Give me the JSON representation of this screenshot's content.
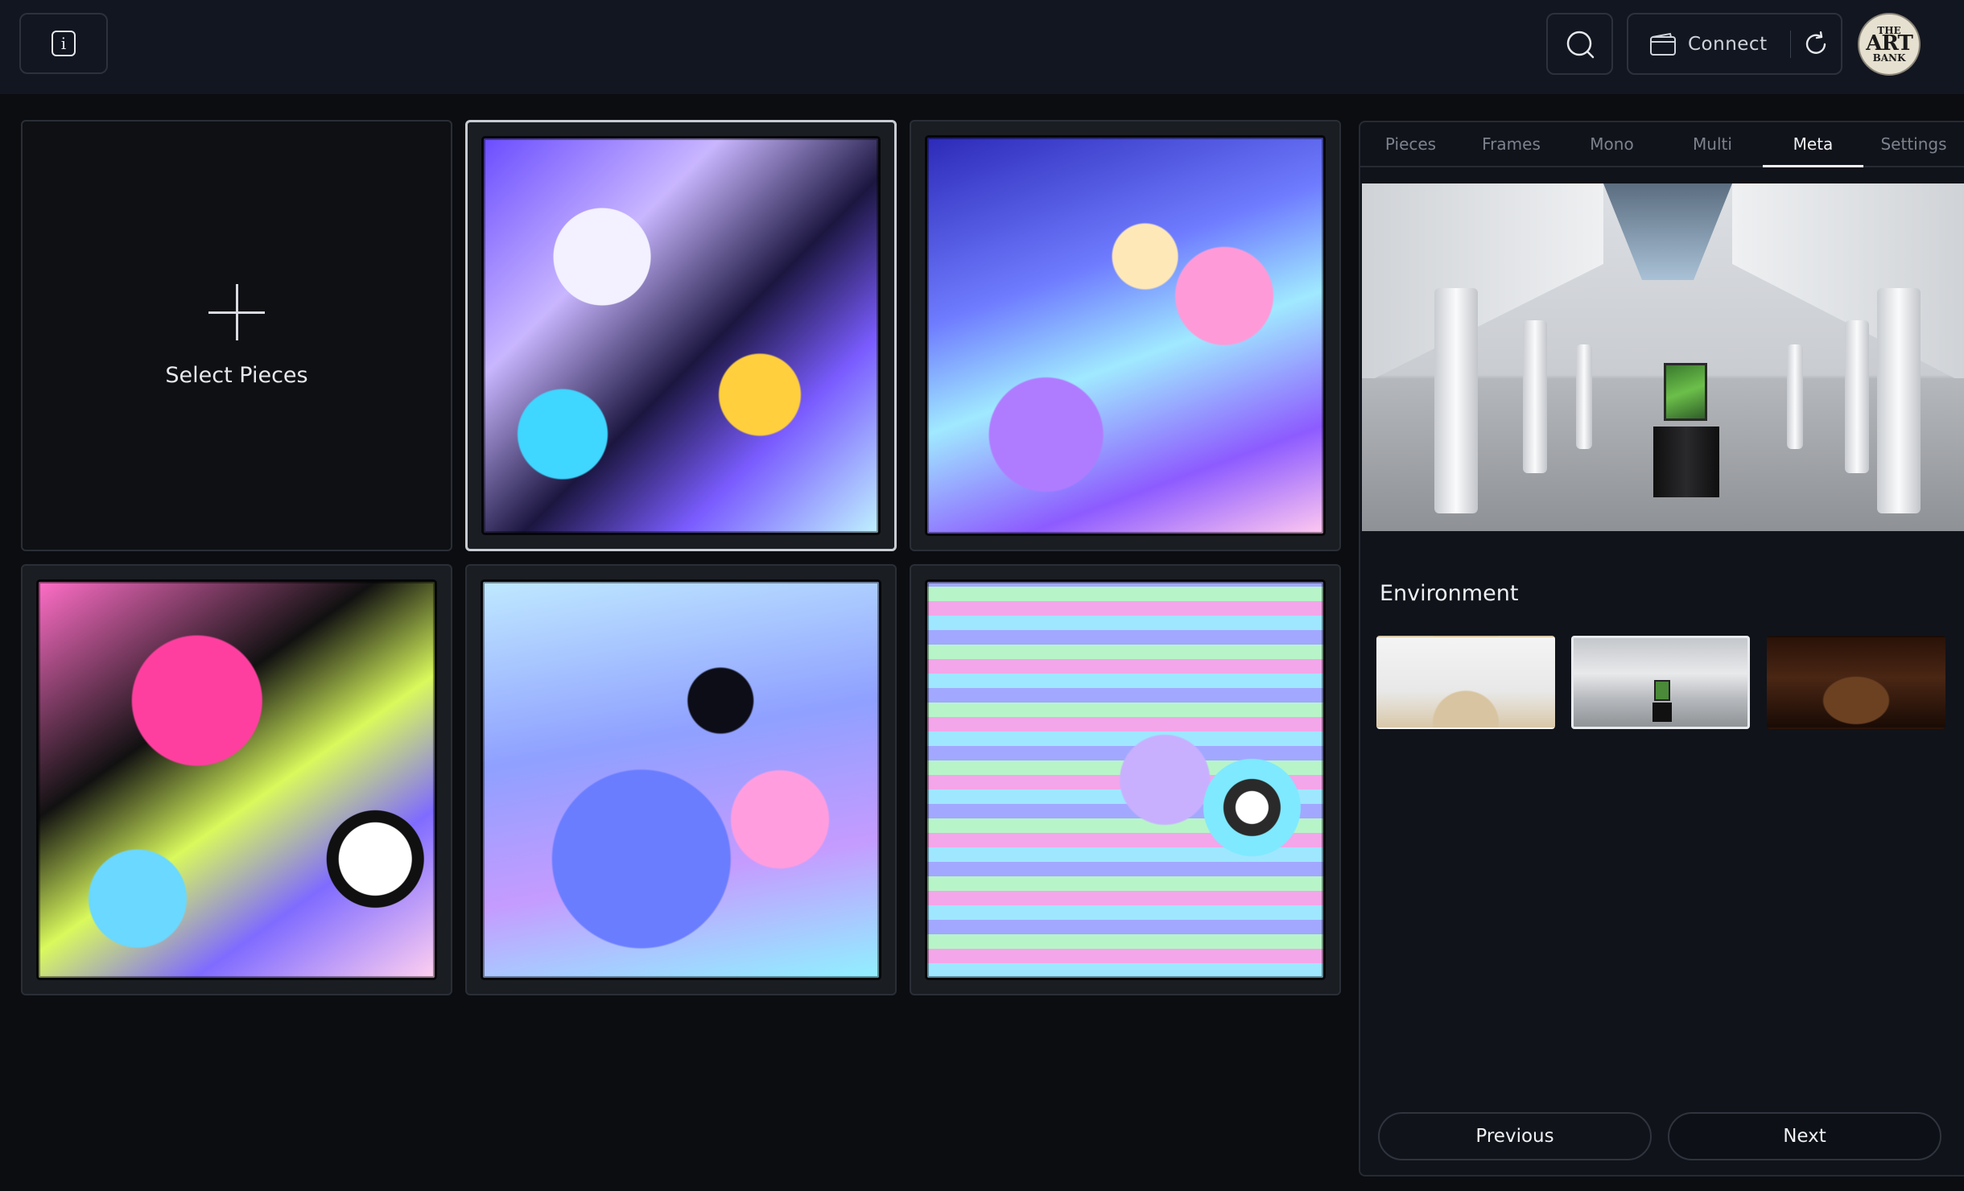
{
  "header": {
    "info_icon": "info-icon",
    "info_glyph": "i",
    "search_icon": "search-icon",
    "connect_label": "Connect",
    "wallet_icon": "wallet-icon",
    "refresh_icon": "refresh-icon",
    "logo": {
      "line1": "THE",
      "line2": "ART",
      "line3": "BANK"
    }
  },
  "grid": {
    "add_label": "Select Pieces",
    "add_icon": "plus-icon",
    "pieces": [
      {
        "name": "artwork-1",
        "selected": true
      },
      {
        "name": "artwork-2",
        "selected": false
      },
      {
        "name": "artwork-3",
        "selected": false
      },
      {
        "name": "artwork-4",
        "selected": false
      },
      {
        "name": "artwork-5",
        "selected": false
      }
    ]
  },
  "panel": {
    "tabs": [
      {
        "label": "Pieces",
        "active": false
      },
      {
        "label": "Frames",
        "active": false
      },
      {
        "label": "Mono",
        "active": false
      },
      {
        "label": "Multi",
        "active": false
      },
      {
        "label": "Meta",
        "active": true
      },
      {
        "label": "Settings",
        "active": false
      }
    ],
    "environment_title": "Environment",
    "environments": [
      {
        "name": "white-gallery",
        "selected": false
      },
      {
        "name": "arched-hall",
        "selected": true
      },
      {
        "name": "dark-wood-room",
        "selected": false
      }
    ],
    "previous_label": "Previous",
    "next_label": "Next"
  },
  "colors": {
    "background": "#0b0d11",
    "topbar": "#121620",
    "panel": "#10131a",
    "border": "#2c313c",
    "text": "#e6e8ec",
    "tab_inactive": "#7c828d"
  }
}
